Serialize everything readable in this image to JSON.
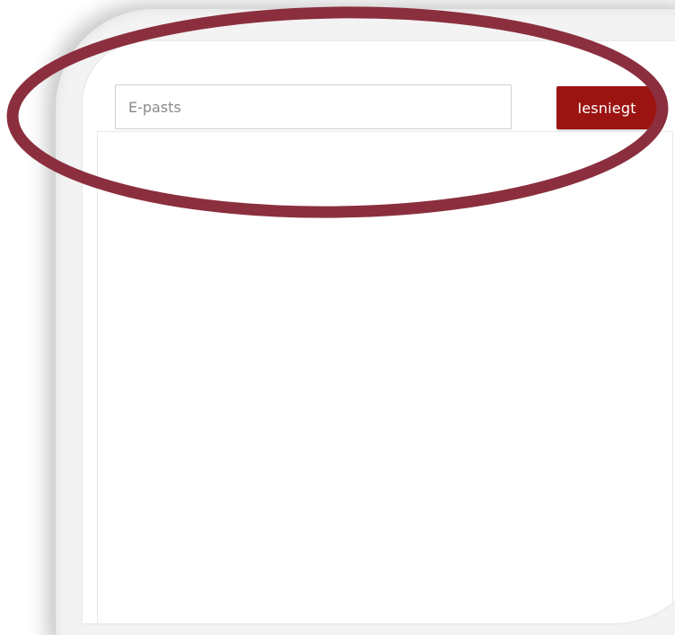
{
  "form": {
    "email_placeholder": "E-pasts",
    "email_value": "",
    "submit_label": "Iesniegt"
  },
  "colors": {
    "button": "#9b1412",
    "highlight_ring": "#8b2f3e",
    "background": "#ffffff"
  },
  "icons": {
    "annotation": "highlight-ellipse"
  }
}
